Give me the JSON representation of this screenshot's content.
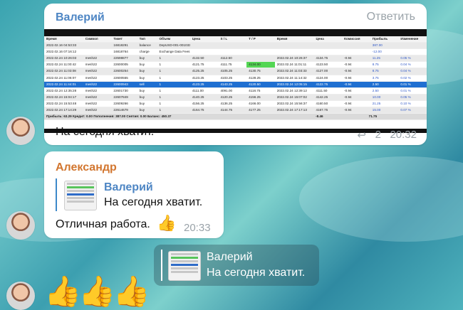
{
  "messages": [
    {
      "sender": "Валерий",
      "reply_label": "Ответить",
      "text": "На сегодня хватит.",
      "reply_count": "2",
      "time": "20:32",
      "screenshot": {
        "headers": [
          "Время",
          "Символ",
          "Тикет",
          "Тип",
          "Объем",
          "Цена",
          "S / L",
          "T / P",
          "Время",
          "Цена",
          "Комиссия",
          "Прибыль",
          "Изменение"
        ],
        "rows": [
          [
            "2022.02.16 04:53:33",
            "",
            "16818291",
            "balance",
            "DepUSD-001-0010334192708",
            "",
            "",
            "",
            "",
            "",
            "",
            "387.00",
            ""
          ],
          [
            "2022.02.16 07:16:12",
            "",
            "16818764",
            "charge",
            "Exchange Data Fees (CME) NonPro",
            "",
            "",
            "",
            "",
            "",
            "",
            "-12.00",
            ""
          ],
          [
            "2022.02.24 10:26:03",
            "mesh22",
            "22598877",
            "buy",
            "1",
            "4132.50",
            "4112.50",
            "",
            "2022.02.24 10:26:37",
            "4134.75",
            "-0.94",
            "11.25",
            "0.05 %"
          ],
          [
            "2022.02.24 11:00:42",
            "mesh22",
            "22600005",
            "buy",
            "1",
            "4121.75",
            "4111.75",
            "4134.00",
            "2022.02.24 11:01:11",
            "4123.50",
            "-0.94",
            "8.75",
            "0.04 %"
          ],
          [
            "2022.02.24 11:03:08",
            "mesh22",
            "22600254",
            "buy",
            "1",
            "4125.25",
            "4105.25",
            "4130.75",
            "2022.02.24 11:03:33",
            "4127.00",
            "-0.94",
            "8.75",
            "0.04 %"
          ],
          [
            "2022.02.24 11:06:07",
            "mesh22",
            "22600555",
            "buy",
            "1",
            "4123.25",
            "4103.25",
            "4128.25",
            "2022.02.24 11:14:32",
            "4124.00",
            "-0.94",
            "3.75",
            "0.02 %"
          ],
          [
            "2022.02.24 11:44:01",
            "mesh22",
            "22600943",
            "sell",
            "1",
            "4123.25",
            "4143.25",
            "4120.50",
            "2022.02.24 12:05:15",
            "4122.75",
            "-0.94",
            "2.50",
            "0.01 %"
          ],
          [
            "2022.02.24 12:35:28",
            "mesh22",
            "22601730",
            "buy",
            "1",
            "4111.00",
            "4091.00",
            "4118.75",
            "2022.02.24 12:39:12",
            "4111.50",
            "-0.94",
            "2.50",
            "0.01 %"
          ],
          [
            "2022.02.24 15:04:17",
            "mesh22",
            "22607849",
            "buy",
            "1",
            "4140.25",
            "4120.25",
            "4156.25",
            "2022.02.24 15:07:02",
            "4142.25",
            "-0.94",
            "10.00",
            "0.05 %"
          ],
          [
            "2022.02.24 15:53:48",
            "mesh22",
            "22609266",
            "buy",
            "1",
            "4156.25",
            "4136.25",
            "4166.00",
            "2022.02.24 15:56:37",
            "4160.50",
            "-0.94",
            "21.25",
            "0.10 %"
          ],
          [
            "2022.02.24 17:14:29",
            "mesh22",
            "22614679",
            "buy",
            "1",
            "4164.75",
            "4144.75",
            "4177.25",
            "2022.02.24 17:17:13",
            "4167.75",
            "-0.94",
            "15.00",
            "0.07 %"
          ]
        ],
        "summary": [
          "Прибыль: 63.29  Кредит: 0.00  Пополнения: 387.00  Снятия: 0.00  Баланс: 450.37",
          "-8.46",
          "71.75"
        ]
      }
    },
    {
      "sender": "Александр",
      "quote_sender": "Валерий",
      "quote_text": "На сегодня хватит.",
      "text": "Отличная работа.",
      "emoji": "👍",
      "time": "20:33"
    },
    {
      "quote_sender": "Валерий",
      "quote_text": "На сегодня хватит."
    },
    {
      "emoji": "👍👍👍"
    }
  ],
  "colors": {
    "valery": "#4e86c4",
    "alexander": "#d2762f",
    "quote_bar": "#3d88c9",
    "muted": "#9aa3a9"
  }
}
